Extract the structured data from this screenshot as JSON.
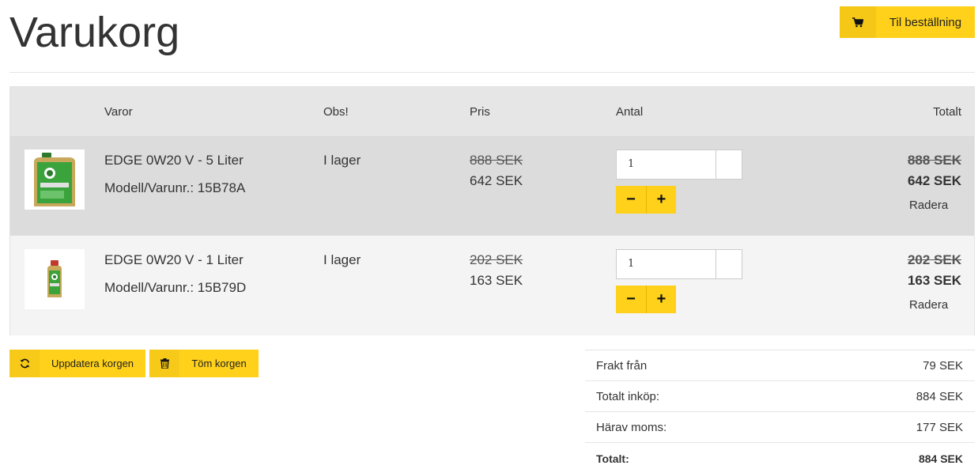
{
  "page": {
    "title": "Varukorg"
  },
  "checkout": {
    "label": "Til beställning",
    "icon": "cart-icon"
  },
  "table": {
    "headers": {
      "product": "Varor",
      "note": "Obs!",
      "price": "Pris",
      "quantity": "Antal",
      "total": "Totalt"
    },
    "rows": [
      {
        "name": "EDGE 0W20 V - 5 Liter",
        "model": "Modell/Varunr.: 15B78A",
        "stock": "I lager",
        "old_price": "888 SEK",
        "price": "642 SEK",
        "quantity": "1",
        "old_total": "888 SEK",
        "total": "642 SEK",
        "remove_label": "Radera",
        "image_icon": "oil-can-5l-icon"
      },
      {
        "name": "EDGE 0W20 V - 1 Liter",
        "model": "Modell/Varunr.: 15B79D",
        "stock": "I lager",
        "old_price": "202 SEK",
        "price": "163 SEK",
        "quantity": "1",
        "old_total": "202 SEK",
        "total": "163 SEK",
        "remove_label": "Radera",
        "image_icon": "oil-bottle-1l-icon"
      }
    ],
    "minus_label": "−",
    "plus_label": "+"
  },
  "actions": {
    "update_label": "Uppdatera korgen",
    "empty_label": "Töm korgen"
  },
  "summary": {
    "shipping_label": "Frakt från",
    "shipping_value": "79 SEK",
    "subtotal_label": "Totalt inköp:",
    "subtotal_value": "884 SEK",
    "vat_label": "Härav moms:",
    "vat_value": "177 SEK",
    "total_label": "Totalt:",
    "total_value": "884 SEK"
  },
  "colors": {
    "accent": "#ffd11a",
    "header_bg": "#e6e6e6",
    "row1_bg": "#dcdcdc",
    "row2_bg": "#f4f4f4"
  }
}
